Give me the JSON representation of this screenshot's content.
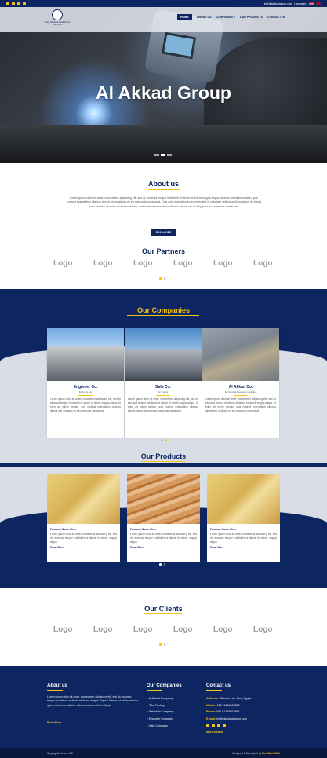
{
  "topbar": {
    "social_icons": [
      "facebook-icon",
      "twitter-icon",
      "youtube-icon",
      "google-plus-icon"
    ],
    "email": "info@alakkadgroup.com",
    "language_label": "Language:"
  },
  "header": {
    "logo_caption": "Eng. Salwan & Akkad Co. For Sub. & Ins.",
    "nav": [
      {
        "label": "HOME",
        "active": true
      },
      {
        "label": "ABOUT US"
      },
      {
        "label": "COMPANIES ▾"
      },
      {
        "label": "OUR PRODUCTS"
      },
      {
        "label": "CONTACT US"
      }
    ]
  },
  "hero": {
    "title": "Al Akkad Group"
  },
  "about": {
    "title": "About us",
    "text": "Lorem ipsum dolor sit amet, consectetur adipiscing elit, sed do eiusmod tempor incididunt ut labore et dolore magna aliqua. Ut enim ad minim veniam, quis nostrud exercitation ullamco laboris nisi ut aliquip ex ea commodo consequat. Duis aute irure dolor in reprehenderit in voluptate velit esse cillum dolore eu fugiat nulla pariatur. Ut enim ad minim veniam, quis nostrud exercitation ullamco laboris nisi ut aliquip ex ea commodo consequat.",
    "button": "READ MORE"
  },
  "partners": {
    "title": "Our Partners",
    "logos": [
      "Logo",
      "Logo",
      "Logo",
      "Logo",
      "Logo",
      "Logo"
    ]
  },
  "companies": {
    "title": "Our Companies",
    "cards": [
      {
        "name": "Engineer Co.",
        "sub": "for imp & exp",
        "text": "Lorem ipsum dolor sit amet, consectetur adipiscing elit, sed do eiusmod tempor incididunt ut labore et dolore magna aliqua. Ut enim ad minim veniam, quis nostrud exercitation ullamco laboris nisi ut aliquip ex ea commodo consequat."
      },
      {
        "name": "Safa Co.",
        "sub": "for trading",
        "text": "Lorem ipsum dolor sit amet, consectetur adipiscing elit, sed do eiusmod tempor incididunt ut labore et dolore magna aliqua. Ut enim ad minim veniam, quis nostrud exercitation ullamco laboris nisi ut aliquip ex ea commodo consequat."
      },
      {
        "name": "Al Akkad Co.",
        "sub": "For thermal & acoustic insulation",
        "text": "Lorem ipsum dolor sit amet, consectetur adipiscing elit, sed do eiusmod tempor incididunt ut labore et dolore magna aliqua. Ut enim ad minim veniam, quis nostrud exercitation ullamco laboris nisi ut aliquip ex ea commodo consequat."
      }
    ]
  },
  "products": {
    "title": "Our Products",
    "cards": [
      {
        "name": "Product Name Here",
        "text": "Lorem ipsum dolor sit amet, consectetur adipiscing elit, sed do eiusmod tempor incididunt ut labore et dolore magna aliqua.",
        "more": "Read More"
      },
      {
        "name": "Product Name Here",
        "text": "Lorem ipsum dolor sit amet, consectetur adipiscing elit, sed do eiusmod tempor incididunt ut labore et dolore magna aliqua.",
        "more": "Read More"
      },
      {
        "name": "Product Name Here",
        "text": "Lorem ipsum dolor sit amet, consectetur adipiscing elit, sed do eiusmod tempor incididunt ut labore et dolore magna aliqua.",
        "more": "Read More"
      }
    ]
  },
  "clients": {
    "title": "Our Clients",
    "logos": [
      "Logo",
      "Logo",
      "Logo",
      "Logo",
      "Logo",
      "Logo"
    ]
  },
  "footer": {
    "about_title": "About us",
    "about_text": "Lorem ipsum dolor sit amet, consectetur adipiscing elit, sed do eiusmod tempor incididunt ut labore et dolore magna aliqua. Ut enim ad minim veniam, quis nostrud exercitation ullamco laboris nisi ut aliquip.",
    "about_more": "Read More..",
    "companies_title": "Our Companies",
    "companies": [
      "Al Akkad Company",
      "Tiba Factory",
      "Safwalan Company",
      "Engineer Company",
      "Safa Company"
    ],
    "contact_title": "Contact us",
    "address_label": "Address:",
    "address": "35 Lorem st., Giza, Egypt.",
    "mobile_label": "Mobile:",
    "mobile": "002 01234567888",
    "phone_label": "Phone:",
    "phone": "002 01234567888",
    "email_label": "E-mail:",
    "email": "info@alakkadgroup.com",
    "more_details": "More Details",
    "copyright": "Copyrights Reserved ©",
    "designed_by": "Designed & Developed by",
    "designer": "IdealWorldWeb"
  },
  "colors": {
    "primary": "#0d2560",
    "accent": "#f5c518",
    "light_gray": "#d9dde5"
  }
}
